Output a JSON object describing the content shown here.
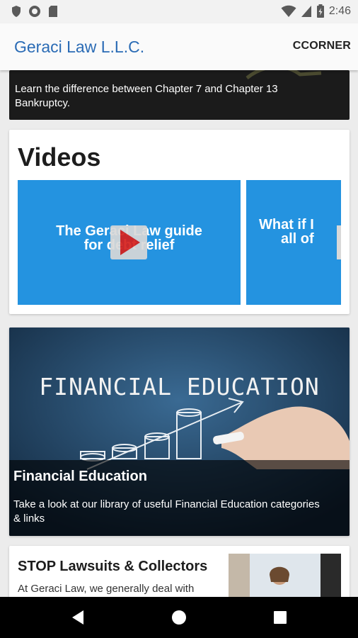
{
  "status_bar": {
    "time": "2:46"
  },
  "app_bar": {
    "title": "Geraci Law L.L.C.",
    "action_label": "CCORNER"
  },
  "top_card": {
    "description": "Learn the difference between Chapter 7 and Chapter 13 Bankruptcy."
  },
  "videos": {
    "heading": "Videos",
    "tiles": [
      {
        "title_line1": "The Geraci Law guide",
        "title_line2": "for debt relief"
      },
      {
        "title_line1": "What if I",
        "title_line2": "all of"
      }
    ]
  },
  "financial_education": {
    "image_text": "FINANCIAL EDUCATION",
    "title": "Financial Education",
    "description": "Take a look at our library of useful Financial Education categories & links"
  },
  "stop_card": {
    "title": "STOP Lawsuits & Collectors",
    "description": "At Geraci Law, we generally deal with"
  },
  "colors": {
    "brand": "#2a6bb5",
    "video_tile": "#2493e0",
    "play_icon": "#d6201c"
  }
}
